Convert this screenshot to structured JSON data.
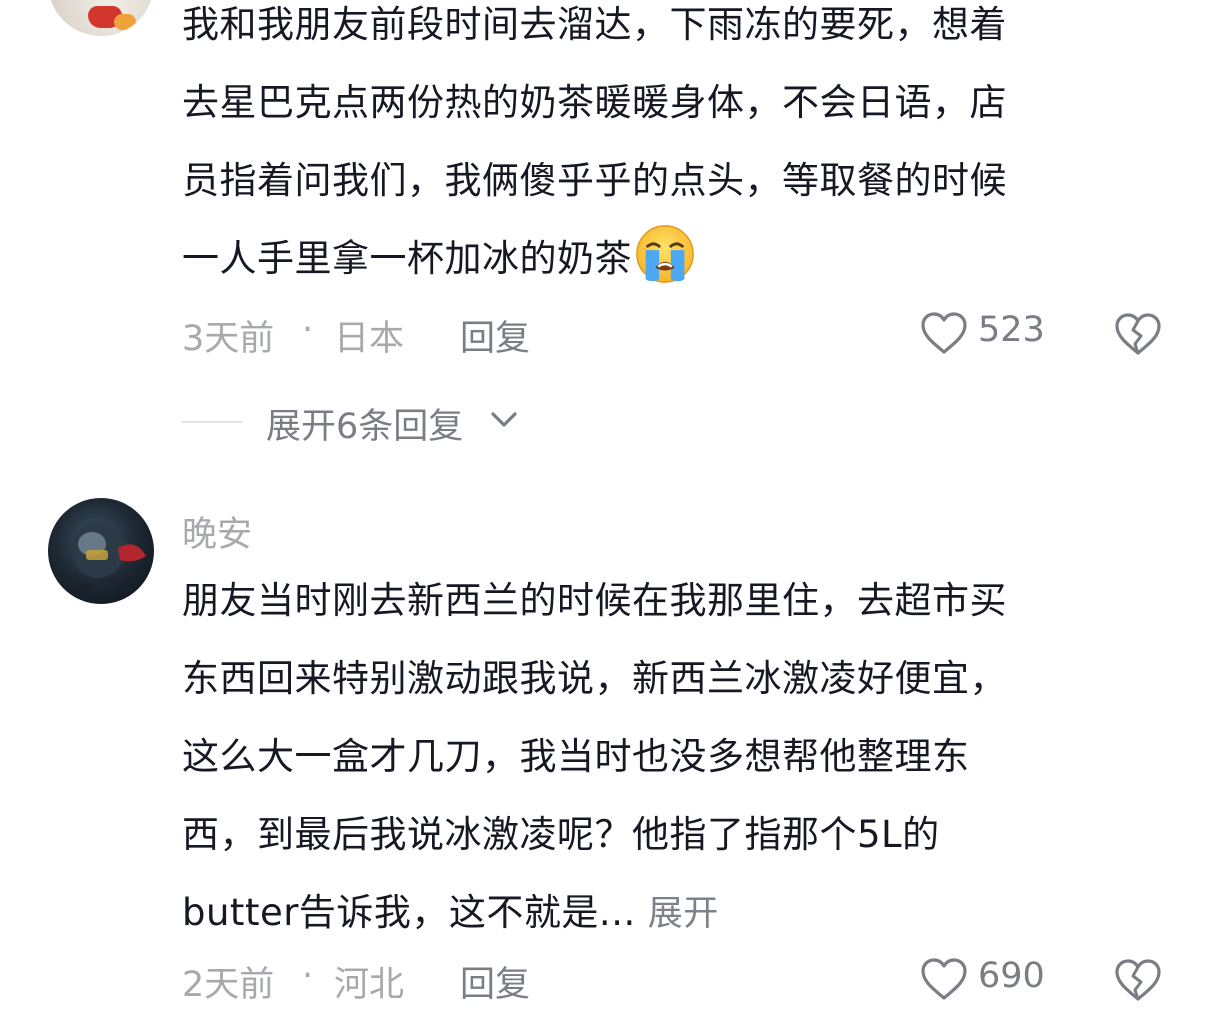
{
  "comments": [
    {
      "text_lines": [
        "我和我朋友前段时间去溜达，下雨冻的要死，想着",
        "去星巴克点两份热的奶茶暖暖身体，不会日语，店",
        "员指着问我们，我俩傻乎乎的点头，等取餐的时候",
        "一人手里拿一杯加冰的奶茶"
      ],
      "emoji": "loudly-crying-face-emoji",
      "time": "3天前",
      "separator": "·",
      "location": "日本",
      "reply_label": "回复",
      "like_count": "523",
      "replies_toggle": "展开6条回复"
    },
    {
      "username": "晚安",
      "text_lines": [
        "朋友当时刚去新西兰的时候在我那里住，去超市买",
        "东西回来特别激动跟我说，新西兰冰激凌好便宜，",
        "这么大一盒才几刀，我当时也没多想帮他整理东",
        "西，到最后我说冰激凌呢？他指了指那个5L的",
        "butter告诉我，这不就是..."
      ],
      "expand_label": "展开",
      "time": "2天前",
      "separator": "·",
      "location": "河北",
      "reply_label": "回复",
      "like_count": "690"
    }
  ],
  "icons": {
    "like": "heart-outline-icon",
    "dislike": "broken-heart-icon",
    "chevron": "chevron-down-icon"
  },
  "colors": {
    "text": "#161823",
    "meta": "#a8a9ad",
    "secondary": "#7b7d85"
  }
}
